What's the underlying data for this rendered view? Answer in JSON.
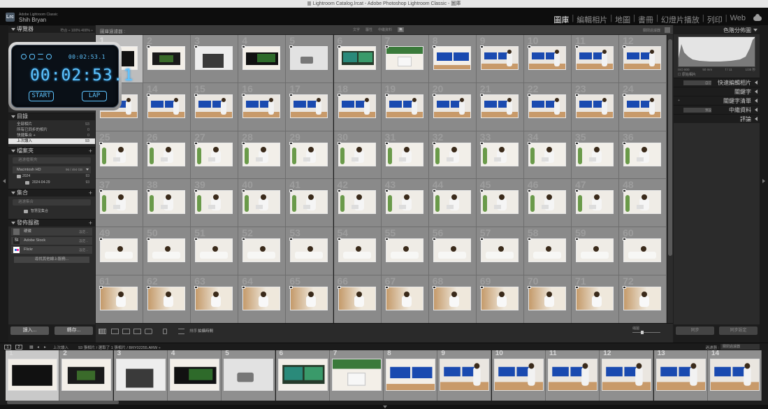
{
  "window_title": "Lightroom Catalog.lrcat - Adobe Photoshop Lightroom Classic - 圖庫",
  "app": {
    "name": "Adobe Lightroom Classic",
    "user": "Shih Bryan",
    "logo": "Lrc"
  },
  "modules": [
    "圖庫",
    "編輯相片",
    "地圖",
    "書冊",
    "幻燈片播放",
    "列印",
    "Web"
  ],
  "active_module": "圖庫",
  "left_panel": {
    "navigator": {
      "title": "導覽器",
      "options": "符合 ÷  100%  400% ÷"
    },
    "catalog": {
      "title": "目錄",
      "items": [
        {
          "label": "全部相片",
          "count": "93"
        },
        {
          "label": "所有已同步的相片",
          "count": "0"
        },
        {
          "label": "快捷集合 +",
          "count": "0"
        },
        {
          "label": "上次讀入",
          "count": "93",
          "selected": true
        }
      ]
    },
    "folders": {
      "title": "檔案夾",
      "search_placeholder": "過濾檔案夾",
      "drive": {
        "label": "Macintosh HD",
        "capacity": "96 / 494 GB"
      },
      "items": [
        {
          "label": "2024",
          "count": "93"
        },
        {
          "label": "2024-04-29",
          "count": "93"
        }
      ]
    },
    "collections": {
      "title": "集合",
      "search_placeholder": "過濾集合",
      "items": [
        {
          "label": "智慧型集合"
        }
      ]
    },
    "publish": {
      "title": "發佈服務",
      "services": [
        {
          "icon": "hdd",
          "label": "硬碟",
          "action": "設定..."
        },
        {
          "icon": "St",
          "label": "Adobe Stock",
          "action": "設定..."
        },
        {
          "icon": "flickr",
          "label": "Flickr",
          "action": "設定..."
        }
      ],
      "find_more": "尋找其他線上服務..."
    },
    "import_label": "讀入...",
    "export_label": "轉存..."
  },
  "stopwatch": {
    "small_time": "00:02:53.1",
    "big_time": "00:02:53.1",
    "start_label": "START",
    "lap_label": "LAP"
  },
  "center": {
    "filter_title": "圖庫過濾器 :",
    "filter_tabs": [
      "文字",
      "屬性",
      "中繼資料",
      "無"
    ],
    "filter_preset": "關閉過濾器",
    "sort_label": "排序 :",
    "sort_value": "拍攝時間",
    "thumbnails_label": "縮圖",
    "selected_index": 1,
    "cells": [
      1,
      2,
      3,
      4,
      5,
      6,
      7,
      8,
      9,
      10,
      11,
      12,
      13,
      14,
      15,
      16,
      17,
      18,
      19,
      20,
      21,
      22,
      23,
      24,
      25,
      26,
      27,
      28,
      29,
      30,
      31,
      32,
      33,
      34,
      35,
      36,
      37,
      38,
      39,
      40,
      41,
      42,
      43,
      44,
      45,
      46,
      47,
      48,
      49,
      50,
      51,
      52,
      53,
      54,
      55,
      56,
      57,
      58,
      59,
      60,
      61,
      62,
      63,
      64,
      65,
      66,
      67,
      68,
      69,
      70,
      71,
      72
    ]
  },
  "right_panel": {
    "histogram": {
      "title": "色階分佈圖",
      "iso": "ISO 800",
      "focal": "50 mm",
      "aperture": "f / 11",
      "shutter": "1/30 秒",
      "original_label": "原始相片"
    },
    "sections": [
      {
        "title": "快速編輯相片",
        "left": "自訂"
      },
      {
        "title": "關鍵字"
      },
      {
        "title": "關鍵字清單",
        "left": "+"
      },
      {
        "title": "中繼資料",
        "left": "預設"
      },
      {
        "title": "評論"
      }
    ],
    "sync_label": "同步",
    "reset_label": "同步設定"
  },
  "filmstrip": {
    "crumb": "上次讀入",
    "info": "93 張相片 / 選取了 1 張相片 / BRY02255.ARW ÷",
    "filter_label": "過濾器 :",
    "filter_value": "關閉過濾器",
    "cells": [
      1,
      2,
      3,
      4,
      5,
      6,
      7,
      8,
      9,
      10,
      11,
      12,
      13,
      14
    ]
  }
}
